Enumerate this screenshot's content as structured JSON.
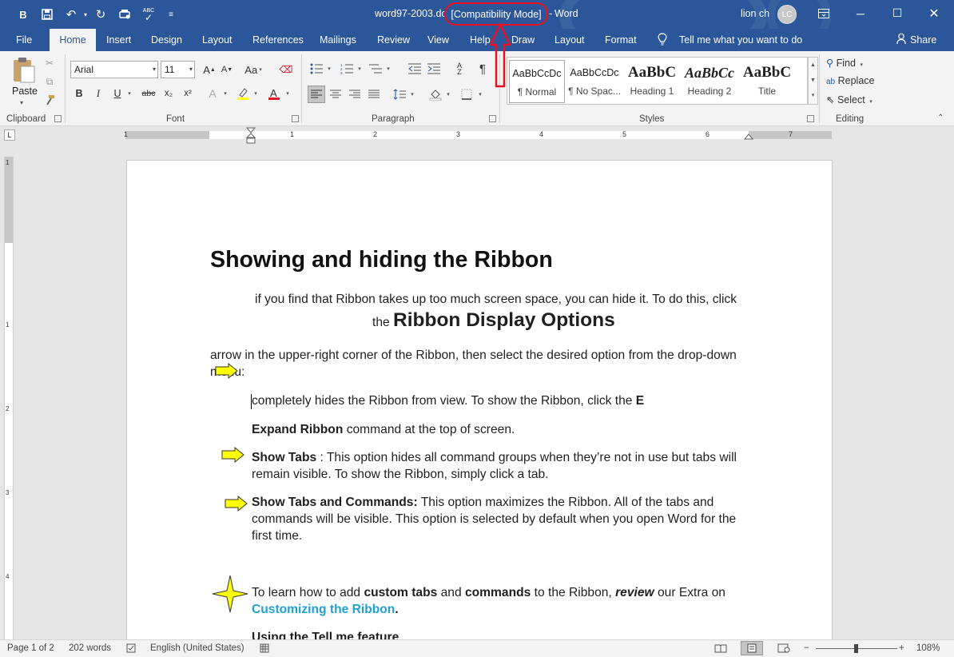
{
  "titlebar": {
    "document_name": "word97-2003.doc",
    "compat_mode": "[Compatibility Mode]",
    "separator": "-",
    "app_name": "Word",
    "user_name": "lion ch",
    "avatar_initials": "LC"
  },
  "quick_access": {
    "icons": [
      "bold-icon",
      "save-icon",
      "undo-icon",
      "redo-icon",
      "print-preview-icon",
      "spelling-icon",
      "customize-icon"
    ]
  },
  "tabs": [
    "File",
    "Home",
    "Insert",
    "Design",
    "Layout",
    "References",
    "Mailings",
    "Review",
    "View",
    "Help",
    "Draw",
    "Layout",
    "Format"
  ],
  "active_tab": "Home",
  "tell_me": "Tell me what you want to do",
  "share": "Share",
  "ribbon": {
    "clipboard": {
      "paste": "Paste",
      "label": "Clipboard"
    },
    "font": {
      "name": "Arial",
      "size": "11",
      "label": "Font",
      "case_btn": "Aa",
      "sizeup": "A",
      "bold": "B",
      "italic": "I",
      "underline": "U",
      "strike": "abc",
      "sub": "x₂",
      "sup": "x²"
    },
    "paragraph": {
      "label": "Paragraph",
      "pilcrow": "¶"
    },
    "styles": {
      "label": "Styles",
      "items": [
        {
          "preview": "AaBbCcDc",
          "name": "¶ Normal"
        },
        {
          "preview": "AaBbCcDc",
          "name": "¶ No Spac..."
        },
        {
          "preview": "AaBbC",
          "name": "Heading 1"
        },
        {
          "preview": "AaBbCc",
          "name": "Heading 2"
        },
        {
          "preview": "AaBbC",
          "name": "Title"
        }
      ]
    },
    "editing": {
      "label": "Editing",
      "find": "Find",
      "replace": "Replace",
      "select": "Select"
    }
  },
  "ruler": {
    "numbers": [
      "1",
      "1",
      "2",
      "3",
      "4",
      "5",
      "6",
      "7"
    ],
    "vnumbers": [
      "1",
      "1",
      "2",
      "3",
      "4"
    ]
  },
  "document": {
    "heading": "Showing and hiding the Ribbon",
    "p1_line1": "if you find that Ribbon takes up too much screen space, you can hide it. To do this, click",
    "p1_the": "the",
    "p1_big": "Ribbon Display Options",
    "p2_line1": "arrow in the upper-right corner of the Ribbon, then select the desired option from the drop-down",
    "p2_line2": "menu:",
    "p3_text": "completely hides the Ribbon from view. To show the Ribbon, click the",
    "p3_bold": "E",
    "p4_bold": "Expand Ribbon",
    "p4_text": " command at the top of screen.",
    "p5_bold": "Show Tabs",
    "p5_text1": " : This option hides all command groups when they’re not in use but tabs will",
    "p5_text2": "remain visible. To show the Ribbon, simply click a tab.",
    "p6_bold": "Show Tabs and Commands:",
    "p6_text1": " This option maximizes the Ribbon. All of the tabs and",
    "p6_text2": "commands will be visible. This option is selected by default when you open Word for the",
    "p6_text3": "first time.",
    "p7_a": "To learn how to add ",
    "p7_b": "custom tabs",
    "p7_c": " and ",
    "p7_d": "commands",
    "p7_e": " to the Ribbon, ",
    "p7_f": "review",
    "p7_g": " our Extra on",
    "p7_link": "Customizing the Ribbon",
    "p7_dot": ".",
    "p8": "Using the Tell me feature"
  },
  "status": {
    "page": "Page 1 of 2",
    "words": "202 words",
    "language": "English (United States)",
    "zoom": "108%",
    "zoom_minus": "−",
    "zoom_plus": "+"
  },
  "colors": {
    "brand": "#2b579a",
    "highlight": "#e81123",
    "link": "#23a0d3",
    "arrow_fill": "#ffff00"
  }
}
